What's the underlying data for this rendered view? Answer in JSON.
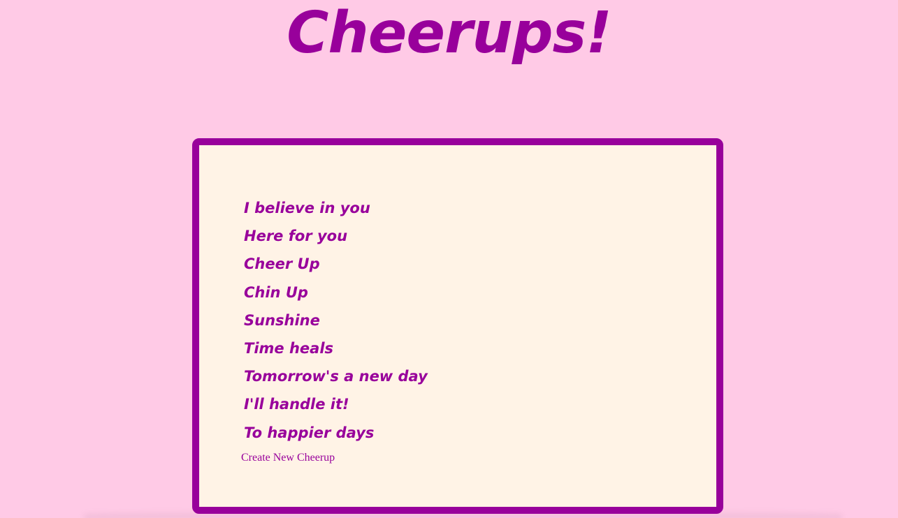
{
  "header": {
    "title": "Cheerups!"
  },
  "cheerups": {
    "items": [
      "I believe in you",
      "Here for you",
      "Cheer Up",
      "Chin Up",
      "Sunshine",
      "Time heals",
      "Tomorrow's a new day",
      "I'll handle it!",
      "To happier days"
    ],
    "create_label": "Create New Cheerup"
  },
  "colors": {
    "background": "#ffcae6",
    "accent": "#98009b",
    "card": "#fff3e6"
  }
}
